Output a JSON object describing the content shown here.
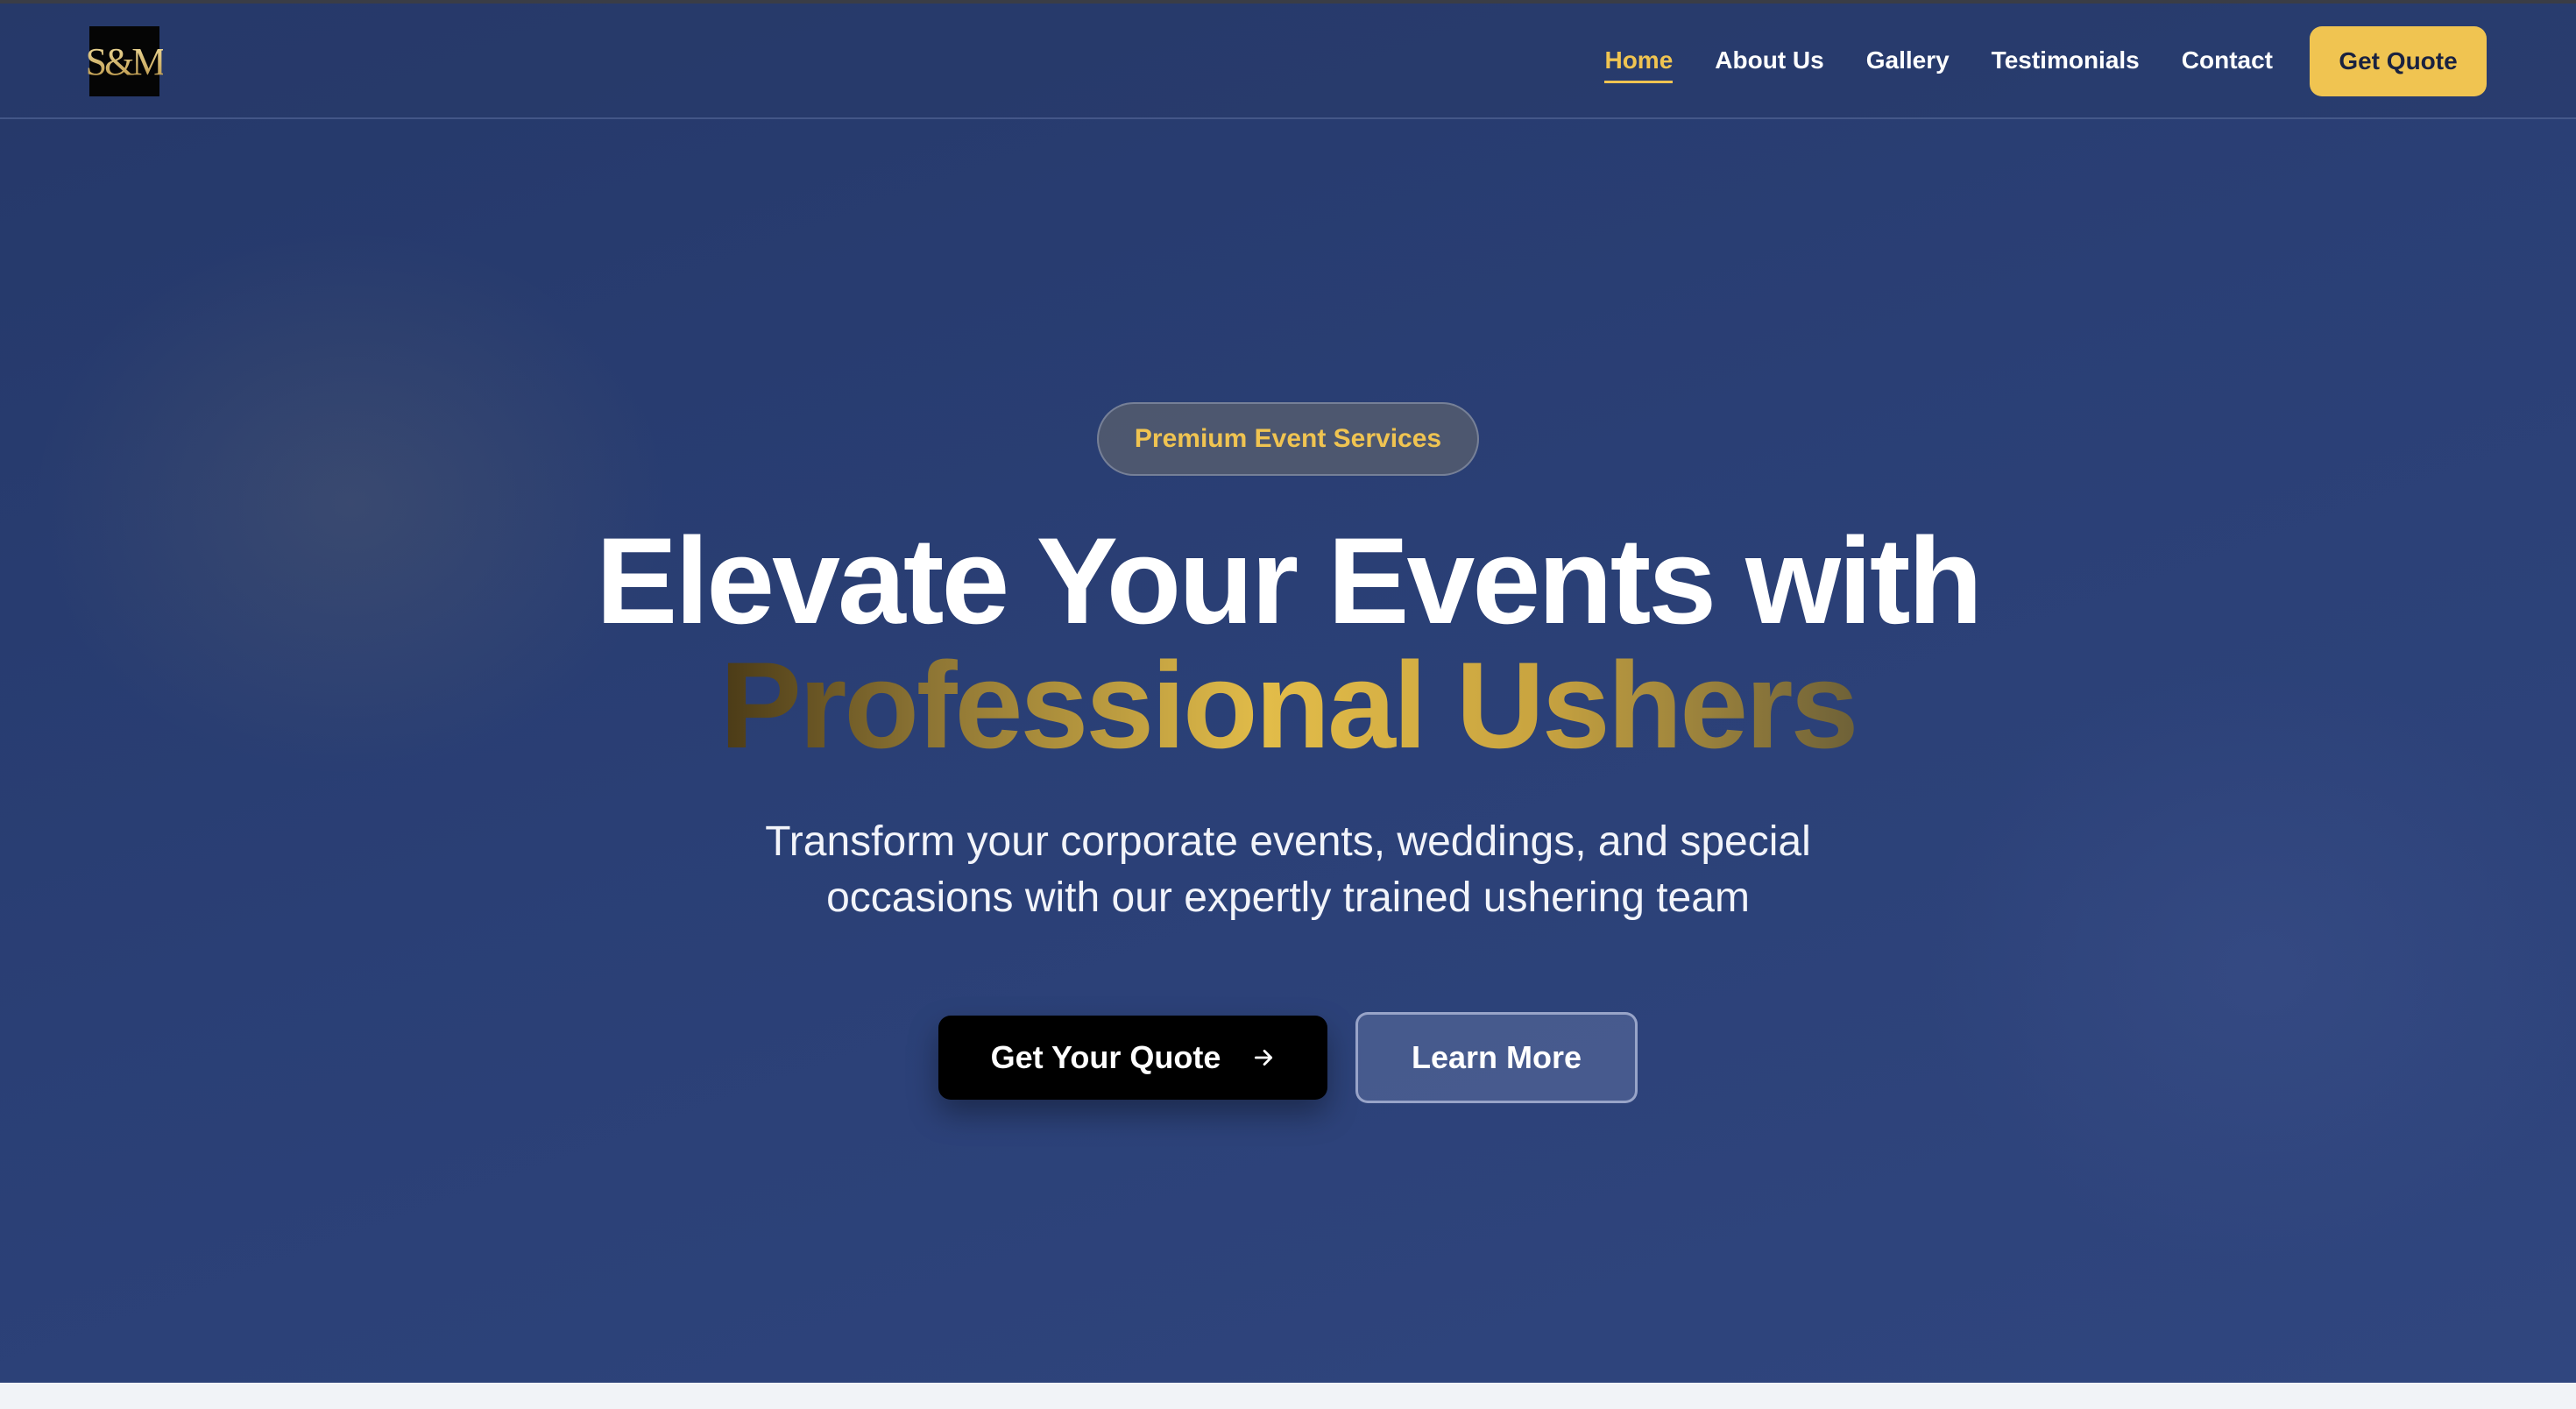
{
  "brand": {
    "logo_text": "S&M"
  },
  "nav": {
    "links": [
      {
        "label": "Home",
        "active": true
      },
      {
        "label": "About Us",
        "active": false
      },
      {
        "label": "Gallery",
        "active": false
      },
      {
        "label": "Testimonials",
        "active": false
      },
      {
        "label": "Contact",
        "active": false
      }
    ],
    "cta_label": "Get Quote"
  },
  "hero": {
    "badge": "Premium Event Services",
    "headline_line1": "Elevate Your Events with",
    "headline_line2": "Professional Ushers",
    "subtitle": "Transform your corporate events, weddings, and special occasions with our expertly trained ushering team",
    "primary_cta": "Get Your Quote",
    "secondary_cta": "Learn More"
  },
  "colors": {
    "accent_gold": "#f0c451",
    "hero_navy": "#2a3f75",
    "primary_button": "#000000"
  },
  "icons": {
    "primary_cta_icon": "arrow-right-icon"
  }
}
